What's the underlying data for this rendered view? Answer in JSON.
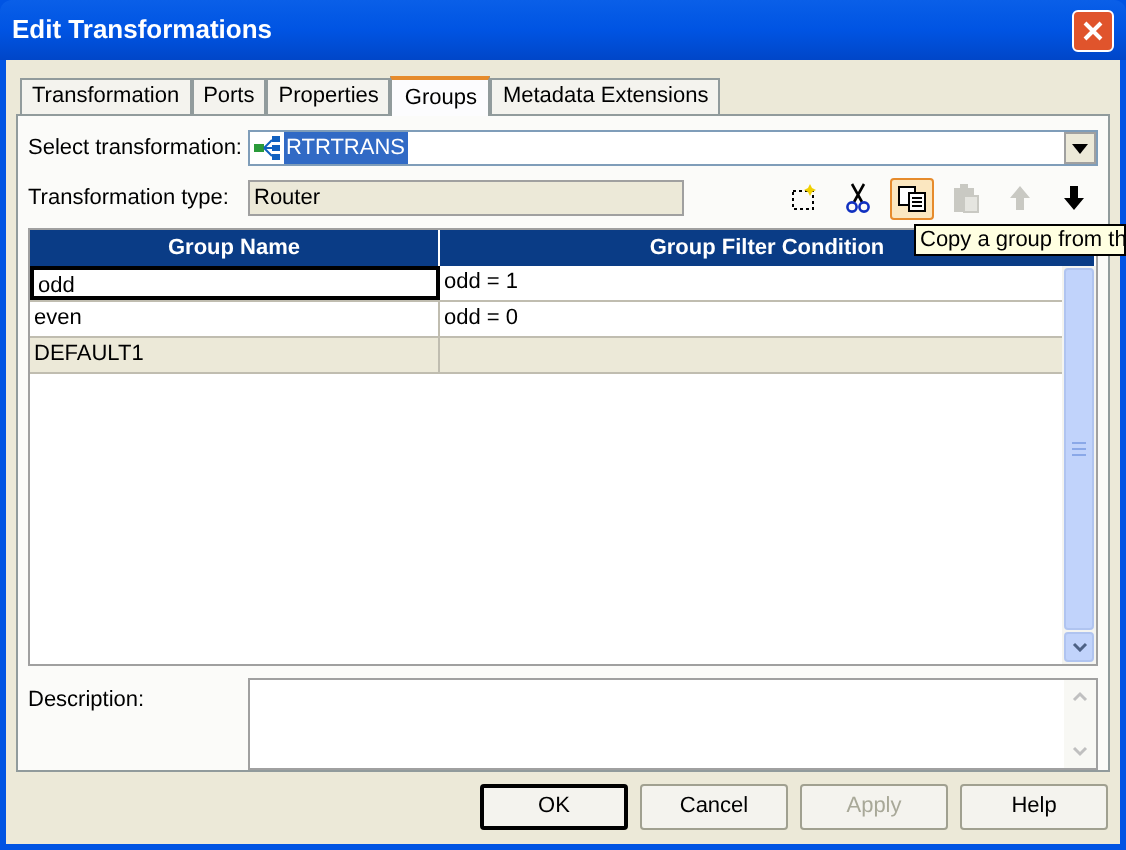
{
  "window": {
    "title": "Edit Transformations"
  },
  "tabs": [
    {
      "label": "Transformation",
      "selected": false
    },
    {
      "label": "Ports",
      "selected": false
    },
    {
      "label": "Properties",
      "selected": false
    },
    {
      "label": "Groups",
      "selected": true
    },
    {
      "label": "Metadata Extensions",
      "selected": false
    }
  ],
  "select_transformation": {
    "label": "Select transformation:",
    "value": "RTRTRANS"
  },
  "transformation_type": {
    "label": "Transformation type:",
    "value": "Router"
  },
  "toolbar": [
    {
      "kind": "new",
      "disabled": false,
      "pressed": false
    },
    {
      "kind": "cut",
      "disabled": false,
      "pressed": false
    },
    {
      "kind": "copy",
      "disabled": false,
      "pressed": true
    },
    {
      "kind": "paste",
      "disabled": true,
      "pressed": false
    },
    {
      "kind": "up",
      "disabled": true,
      "pressed": false
    },
    {
      "kind": "down",
      "disabled": false,
      "pressed": false
    }
  ],
  "tooltip": "Copy a group from th",
  "table": {
    "columns": [
      "Group Name",
      "Group Filter Condition"
    ],
    "rows": [
      {
        "name": "odd",
        "condition": "odd = 1",
        "selected": true,
        "disabled": false
      },
      {
        "name": "even",
        "condition": "odd = 0",
        "selected": false,
        "disabled": false
      },
      {
        "name": "DEFAULT1",
        "selected": false,
        "disabled": true
      }
    ]
  },
  "description": {
    "label": "Description:"
  },
  "buttons": [
    {
      "label": "OK",
      "default": true,
      "disabled": false
    },
    {
      "label": "Cancel",
      "default": false,
      "disabled": false
    },
    {
      "label": "Apply",
      "default": false,
      "disabled": true
    },
    {
      "label": "Help",
      "default": false,
      "disabled": false
    }
  ]
}
